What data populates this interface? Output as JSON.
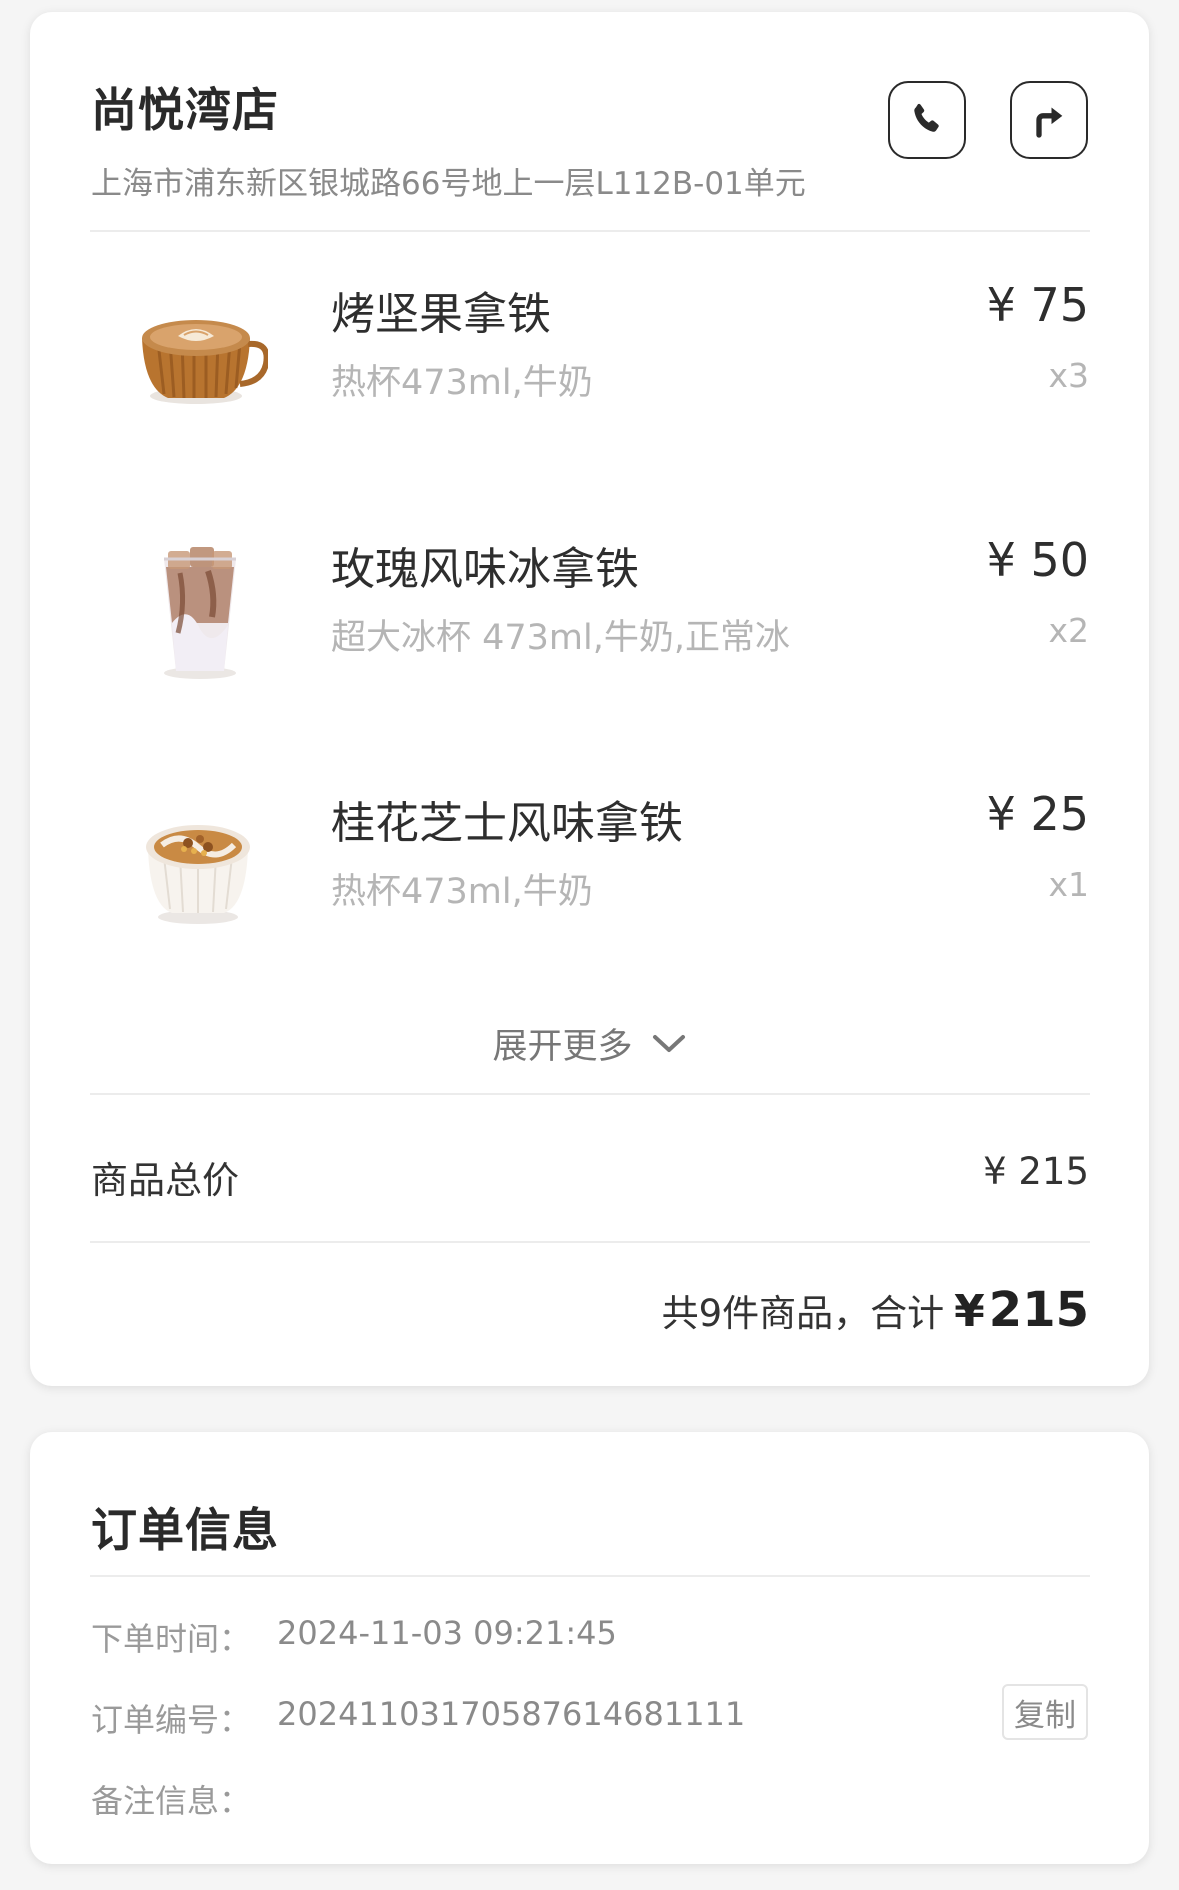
{
  "store": {
    "name": "尚悦湾店",
    "address": "上海市浦东新区银城路66号地上一层L112B-01单元",
    "phone_icon": "phone-icon",
    "nav_icon": "turn-right-arrow-icon"
  },
  "items": [
    {
      "name": "烤坚果拿铁",
      "spec": "热杯473ml,牛奶",
      "price": "¥ 75",
      "qty": "x3",
      "image": "latte-cup-image"
    },
    {
      "name": "玫瑰风味冰拿铁",
      "spec": "超大冰杯 473ml,牛奶,正常冰",
      "price": "¥ 50",
      "qty": "x2",
      "image": "iced-latte-image"
    },
    {
      "name": "桂花芝士风味拿铁",
      "spec": "热杯473ml,牛奶",
      "price": "¥ 25",
      "qty": "x1",
      "image": "osmanthus-latte-image"
    }
  ],
  "expand_label": "展开更多",
  "subtotal": {
    "label": "商品总价",
    "value": "¥ 215"
  },
  "total": {
    "text": "共9件商品，合计",
    "currency": "¥",
    "amount": "215"
  },
  "order": {
    "title": "订单信息",
    "time_label": "下单时间：",
    "time_value": "2024-11-03 09:21:45",
    "number_label": "订单编号：",
    "number_value": "20241103170587614681111",
    "copy_label": "复制",
    "note_label": "备注信息："
  },
  "colors": {
    "text_primary": "#2e2e2e",
    "text_muted": "#b5b5b5",
    "background": "#f5f5f5",
    "card": "#ffffff"
  }
}
